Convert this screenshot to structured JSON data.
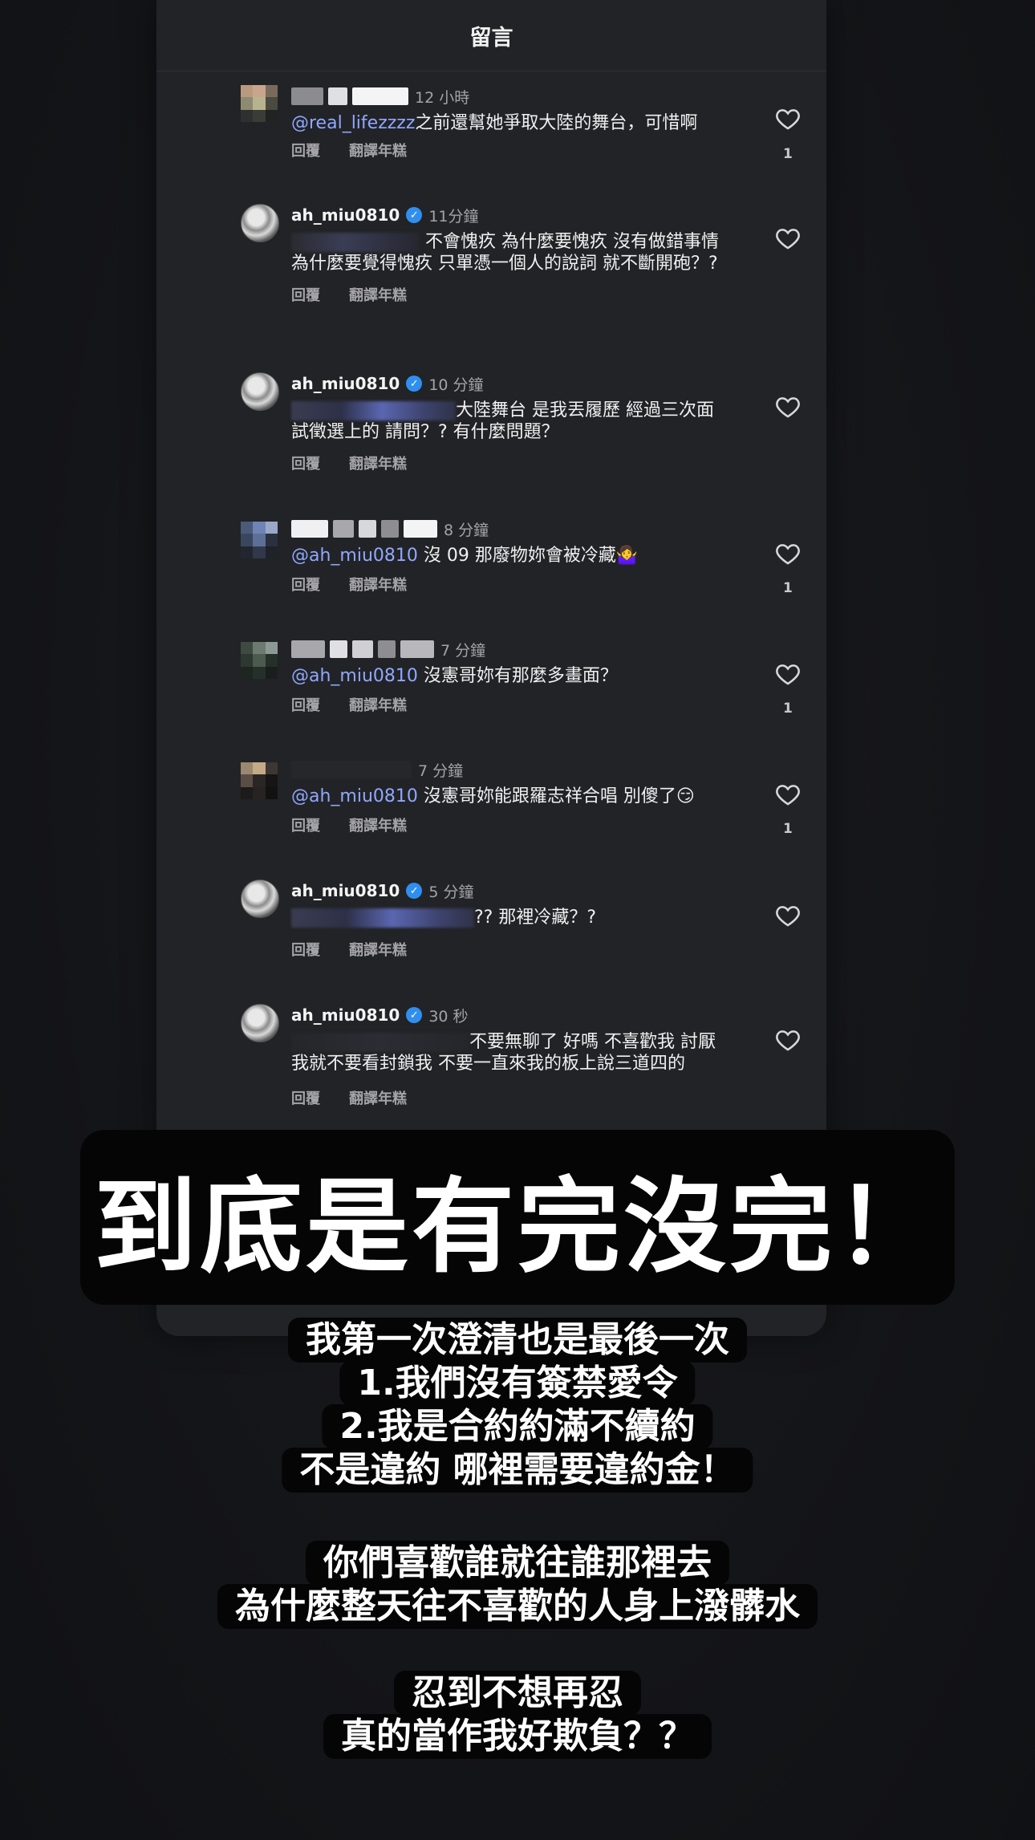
{
  "panel": {
    "title": "留言"
  },
  "comments": [
    {
      "time": "12 小時",
      "mention": "@real_lifezzzz",
      "text": "之前還幫她爭取大陸的舞台，可惜啊",
      "reply": "回覆",
      "translate": "翻譯年糕",
      "likes": "1"
    },
    {
      "username": "ah_miu0810",
      "time": "11分鐘",
      "line1": "不會愧疚 為什麼要愧疚 沒有做錯事情",
      "line2": "為什麼要覺得愧疚 只單憑一個人的說詞 就不斷開砲？?",
      "reply": "回覆",
      "translate": "翻譯年糕"
    },
    {
      "username": "ah_miu0810",
      "time": "10 分鐘",
      "line1": "大陸舞台 是我丟履歷 經過三次面",
      "line2": "試徵選上的 請問？? 有什麼問題？",
      "reply": "回覆",
      "translate": "翻譯年糕"
    },
    {
      "time": "8 分鐘",
      "mention": "@ah_miu0810",
      "text": "沒 09 那廢物妳會被冷藏🤷‍♀️",
      "reply": "回覆",
      "translate": "翻譯年糕",
      "likes": "1"
    },
    {
      "time": "7 分鐘",
      "mention": "@ah_miu0810",
      "text": "沒憲哥妳有那麼多畫面？",
      "reply": "回覆",
      "translate": "翻譯年糕",
      "likes": "1"
    },
    {
      "time": "7 分鐘",
      "mention": "@ah_miu0810",
      "text": "沒憲哥妳能跟羅志祥合唱 別傻了😏",
      "reply": "回覆",
      "translate": "翻譯年糕",
      "likes": "1"
    },
    {
      "username": "ah_miu0810",
      "time": "5 分鐘",
      "text": "?? 那裡冷藏？?",
      "reply": "回覆",
      "translate": "翻譯年糕"
    },
    {
      "username": "ah_miu0810",
      "time": "30 秒",
      "line1": "不要無聊了 好嗎 不喜歡我 討厭",
      "line2": "我就不要看封鎖我 不要一直來我的板上說三道四的",
      "reply": "回覆",
      "translate": "翻譯年糕"
    }
  ],
  "captions": {
    "headline": "到底是有完沒完！",
    "p1": [
      "我第一次澄清也是最後一次",
      "1.我們沒有簽禁愛令",
      "2.我是合約約滿不續約",
      "不是違約 哪裡需要違約金！"
    ],
    "p2": [
      "你們喜歡誰就往誰那裡去",
      "為什麼整天往不喜歡的人身上潑髒水"
    ],
    "p3": [
      "忍到不想再忍",
      "真的當作我好欺負？？"
    ]
  }
}
